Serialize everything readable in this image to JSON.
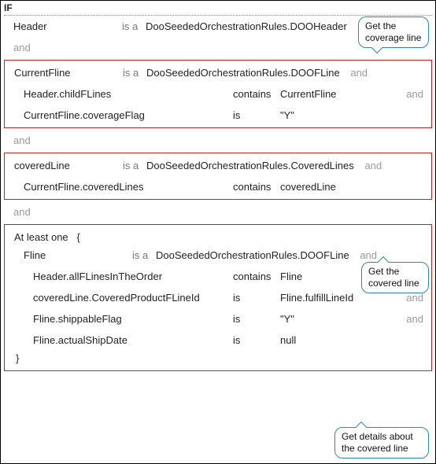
{
  "keywords": {
    "if": "IF",
    "is_a": "is a",
    "and": "and",
    "at_least_one": "At least one",
    "open_brace": "{",
    "close_brace": "}"
  },
  "header_row": {
    "var": "Header",
    "type": "DooSeededOrchestrationRules.DOOHeader"
  },
  "block1": {
    "row": {
      "var": "CurrentFline",
      "type": "DooSeededOrchestrationRules.DOOFLine"
    },
    "lines": [
      {
        "left": "Header.childFLines",
        "op": "contains",
        "val": "CurrentFline",
        "trailing_and": true
      },
      {
        "left": "CurrentFline.coverageFlag",
        "op": "is",
        "val": "\"Y\"",
        "trailing_and": false
      }
    ]
  },
  "block2": {
    "row": {
      "var": "coveredLine",
      "type": "DooSeededOrchestrationRules.CoveredLines"
    },
    "lines": [
      {
        "left": "CurrentFline.coveredLines",
        "op": "contains",
        "val": "coveredLine",
        "trailing_and": false
      }
    ]
  },
  "block3": {
    "row": {
      "var": "Fline",
      "type": "DooSeededOrchestrationRules.DOOFLine"
    },
    "lines": [
      {
        "left": "Header.allFLinesInTheOrder",
        "op": "contains",
        "val": "Fline",
        "trailing_and": true
      },
      {
        "left": "coveredLine.CoveredProductFLineId",
        "op": "is",
        "val": "Fline.fulfillLineId",
        "trailing_and": true
      },
      {
        "left": "Fline.shippableFlag",
        "op": "is",
        "val": "\"Y\"",
        "trailing_and": true
      },
      {
        "left": "Fline.actualShipDate",
        "op": "is",
        "val": "null",
        "trailing_and": false
      }
    ]
  },
  "callouts": {
    "coverage_line": "Get the coverage  line",
    "covered_line": "Get the covered  line",
    "details": "Get details about the covered  line"
  }
}
